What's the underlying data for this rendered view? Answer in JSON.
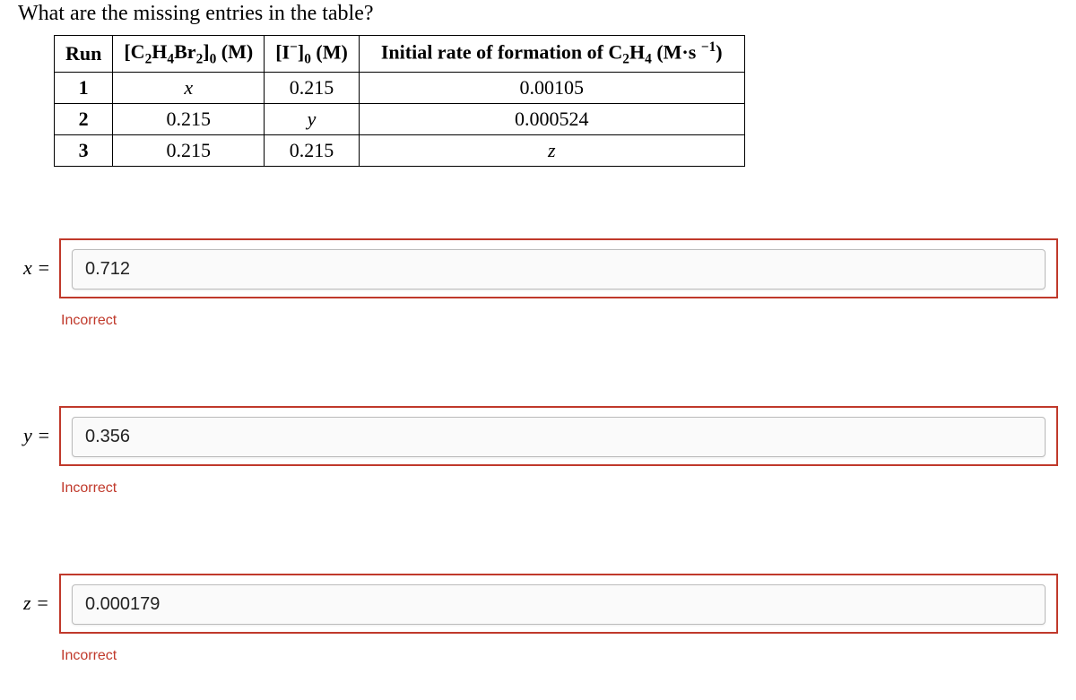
{
  "question": "What are the missing entries in the table?",
  "table": {
    "headers": {
      "run": "Run",
      "c2h4br2_label": "[C2H4Br2]0 (M)",
      "i_label": "[I−]0 (M)",
      "rate_label": "Initial rate of formation of C2H4 (M·s −1)"
    },
    "rows": [
      {
        "run": "1",
        "c": "x",
        "i": "0.215",
        "rate": "0.00105"
      },
      {
        "run": "2",
        "c": "0.215",
        "i": "y",
        "rate": "0.000524"
      },
      {
        "run": "3",
        "c": "0.215",
        "i": "0.215",
        "rate": "z"
      }
    ]
  },
  "answers": {
    "x": {
      "label": "x =",
      "value": "0.712",
      "feedback": "Incorrect"
    },
    "y": {
      "label": "y =",
      "value": "0.356",
      "feedback": "Incorrect"
    },
    "z": {
      "label": "z =",
      "value": "0.000179",
      "feedback": "Incorrect"
    }
  }
}
